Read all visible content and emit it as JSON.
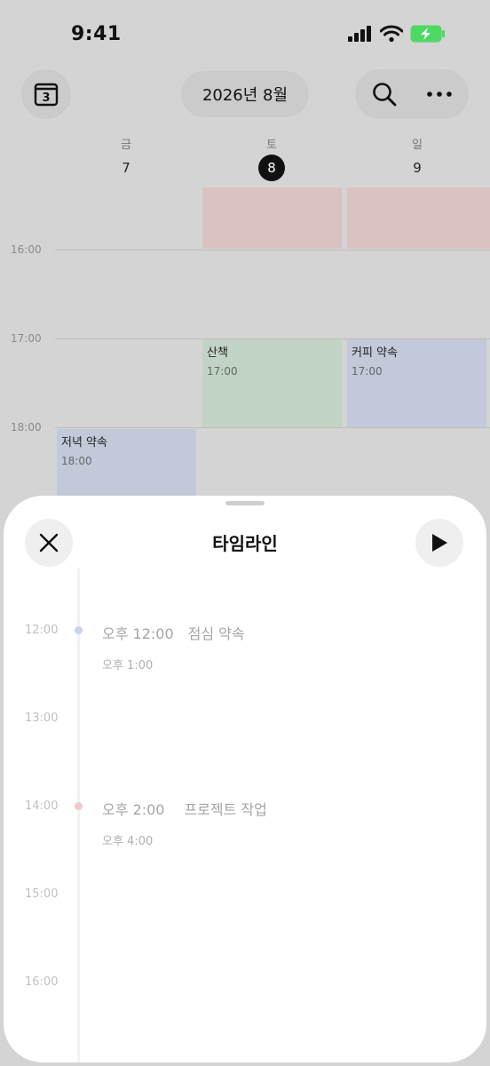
{
  "status_bar": {
    "time": "9:41"
  },
  "header": {
    "calendar_day": "3",
    "month_title": "2026년 8월"
  },
  "days": [
    {
      "dow": "금",
      "num": "7"
    },
    {
      "dow": "토",
      "num": "8",
      "today": true
    },
    {
      "dow": "일",
      "num": "9"
    }
  ],
  "grid": {
    "time_labels": [
      "16:00",
      "17:00",
      "18:00"
    ],
    "events": {
      "walk": {
        "title": "산책",
        "time": "17:00"
      },
      "coffee": {
        "title": "커피 약속",
        "time": "17:00"
      },
      "dinner": {
        "title": "저녁 약속",
        "time": "18:00"
      }
    }
  },
  "sheet": {
    "title": "타임라인",
    "hours": [
      "12:00",
      "13:00",
      "14:00",
      "15:00",
      "16:00"
    ],
    "events": [
      {
        "start": "오후 12:00",
        "name": "점심 약속",
        "end": "오후 1:00",
        "color": "#c9d2ee"
      },
      {
        "start": "오후 2:00",
        "name": "프로젝트 작업",
        "end": "오후 4:00",
        "color": "#f2c9c9"
      }
    ]
  },
  "colors": {
    "red_event": "#dcc1c1",
    "green_event": "#c1d3c3",
    "blue_event": "#c2c9d8",
    "battery": "#4cd964"
  }
}
